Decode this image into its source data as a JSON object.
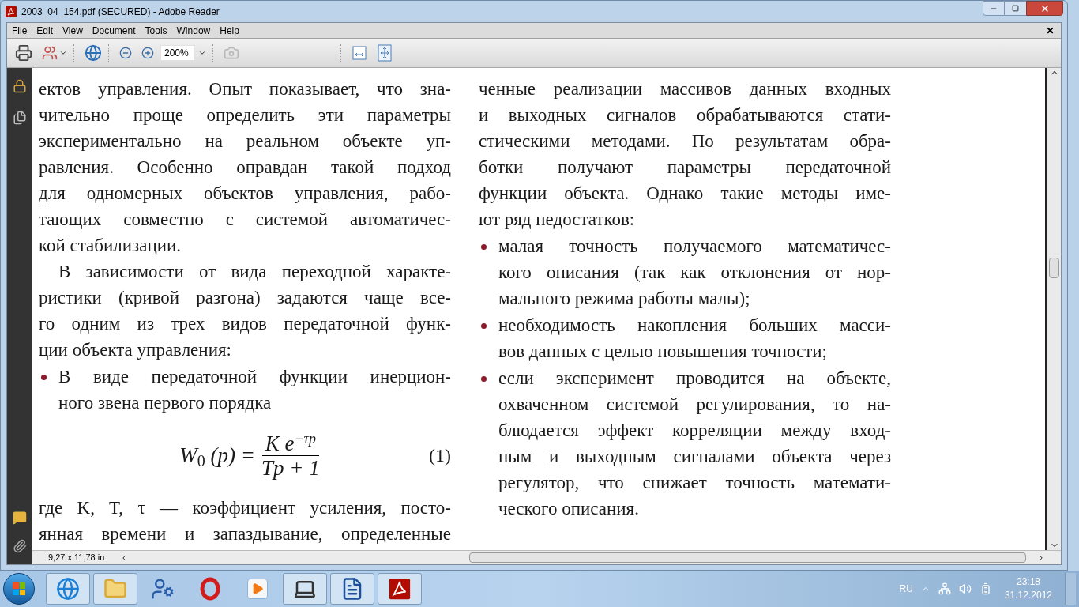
{
  "window": {
    "title": "2003_04_154.pdf (SECURED) - Adobe Reader"
  },
  "menu": [
    {
      "label": "File"
    },
    {
      "label": "Edit"
    },
    {
      "label": "View"
    },
    {
      "label": "Document"
    },
    {
      "label": "Tools"
    },
    {
      "label": "Window"
    },
    {
      "label": "Help"
    }
  ],
  "toolbar": {
    "groups": [
      [
        {
          "kind": "print"
        },
        {
          "kind": "share"
        }
      ],
      [
        {
          "kind": "secure"
        }
      ],
      [
        {
          "kind": "zoom-out"
        },
        {
          "kind": "zoom-in"
        },
        {
          "kind": "zoom-field",
          "value": "200%"
        }
      ],
      [
        {
          "kind": "snapshot",
          "disabled": true
        }
      ],
      [
        {
          "kind": "fit-width"
        },
        {
          "kind": "fit-page"
        }
      ]
    ]
  },
  "document": {
    "columns": [
      {
        "blocks": [
          {
            "kind": "para",
            "indent": false,
            "continues": false,
            "lines": [
              "ектов управления. Опыт показывает, что зна-",
              "чительно проще определить эти параметры",
              "экспериментально на реальном объекте уп-",
              "равления. Особенно оправдан такой подход",
              "для одномерных объектов управления, рабо-",
              "тающих совместно с системой автоматичес-",
              "кой стабилизации."
            ]
          },
          {
            "kind": "para",
            "indent": true,
            "continues": false,
            "lines": [
              "В зависимости от вида переходной характе-",
              "ристики (кривой разгона) задаются чаще все-",
              "го одним из трех видов передаточной функ-",
              "ции объекта управления:"
            ]
          },
          {
            "kind": "bullet",
            "continues": false,
            "lines": [
              "В виде передаточной функции инерцион-",
              "ного звена первого порядка"
            ]
          },
          {
            "kind": "formula",
            "lhs": "W",
            "lhs_sub": "0",
            "arg": "(p) =",
            "numerator": "K e",
            "numerator_sup": "−τp",
            "denominator": "Tp + 1",
            "number": "(1)"
          },
          {
            "kind": "para",
            "indent": false,
            "continues": true,
            "lines": [
              "где K, T, τ — коэффициент усиления, посто-",
              "янная времени и запаздывание, определенные"
            ]
          }
        ]
      },
      {
        "blocks": [
          {
            "kind": "para",
            "indent": false,
            "continues": false,
            "lines": [
              "ченные реализации массивов данных входных",
              "и выходных сигналов обрабатываются стати-",
              "стическими методами. По результатам обра-",
              "ботки получают параметры передаточной",
              "функции объекта. Однако такие методы име-",
              "ют ряд недостатков:"
            ]
          },
          {
            "kind": "bullet",
            "continues": false,
            "lines": [
              "малая точность получаемого математичес-",
              "кого описания (так как отклонения от нор-",
              "мального режима работы малы);"
            ]
          },
          {
            "kind": "bullet",
            "continues": false,
            "lines": [
              "необходимость накопления больших масси-",
              "вов данных с целью повышения точности;"
            ]
          },
          {
            "kind": "bullet",
            "continues": false,
            "lines": [
              "если эксперимент проводится на объекте,",
              "охваченном системой регулирования, то на-",
              "блюдается эффект корреляции между вход-",
              "ным и выходным сигналами объекта через",
              "регулятор, что снижает точность математи-",
              "ческого описания."
            ]
          }
        ]
      }
    ]
  },
  "status_bar": {
    "page_size": "9,27 x 11,78 in"
  },
  "taskbar": {
    "apps": [
      {
        "kind": "browser",
        "running": true
      },
      {
        "kind": "folder",
        "running": true
      },
      {
        "kind": "user-app",
        "running": false
      },
      {
        "kind": "opera",
        "running": false
      },
      {
        "kind": "media",
        "running": false
      },
      {
        "kind": "laptop",
        "running": true
      },
      {
        "kind": "word",
        "running": true
      },
      {
        "kind": "pdf",
        "running": true
      }
    ],
    "tray": {
      "language": "RU",
      "time": "23:18",
      "date": "31.12.2012"
    }
  }
}
